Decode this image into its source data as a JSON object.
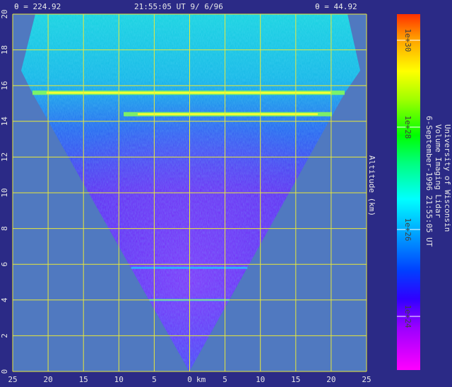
{
  "header": {
    "theta_left": "θ = 224.92",
    "datetime": "21:55:05 UT  9/ 6/96",
    "theta_right": "θ = 44.92"
  },
  "chart_data": {
    "type": "heatmap",
    "xlabel": "km",
    "ylabel": "Altitude (km)",
    "x_ticks": [
      "25",
      "20",
      "15",
      "10",
      "5",
      "0",
      "5",
      "10",
      "15",
      "20",
      "25"
    ],
    "y_ticks": [
      "0",
      "2",
      "4",
      "6",
      "8",
      "10",
      "12",
      "14",
      "16",
      "18",
      "20"
    ],
    "xlim": [
      -25,
      25
    ],
    "ylim": [
      0,
      20
    ],
    "grid": true,
    "colorbar": {
      "labels": [
        "1e+24",
        "1e+26",
        "1e+28",
        "1e+30"
      ],
      "scale": "log",
      "colormap": [
        "#ff00ff",
        "#9a00ff",
        "#3000ff",
        "#0040ff",
        "#00a0ff",
        "#00ffff",
        "#00ff80",
        "#00ff00",
        "#a0ff00",
        "#ffff00",
        "#ffa000",
        "#ff3000"
      ]
    },
    "layers": [
      {
        "altitude_km": 15.6,
        "strength": "high"
      },
      {
        "altitude_km": 14.4,
        "strength": "high"
      },
      {
        "altitude_km": 5.8,
        "strength": "low"
      },
      {
        "altitude_km": 4.0,
        "strength": "low"
      }
    ]
  },
  "side_text": {
    "line1": "University of Wisconsin",
    "line2": "Volume Imaging Lidar",
    "line3": "6-September-1996 21:55:05 UT"
  },
  "colors": {
    "background": "#2b2a86",
    "plot_bg": "#5079c0",
    "grid": "#e8e838",
    "text": "#e8e8e8"
  }
}
